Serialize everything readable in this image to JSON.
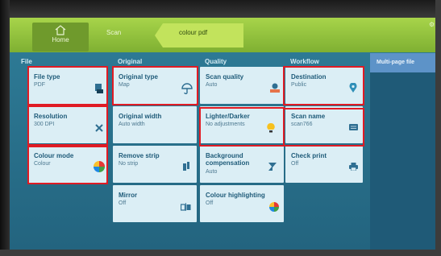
{
  "header": {
    "home_label": "Home",
    "crumb_scan": "Scan",
    "crumb_current": "colour pdf"
  },
  "columns": {
    "file": "File",
    "original": "Original",
    "quality": "Quality",
    "workflow": "Workflow"
  },
  "side_panel": {
    "title": "Multi-page file"
  },
  "tiles": {
    "file_type": {
      "title": "File type",
      "value": "PDF"
    },
    "resolution": {
      "title": "Resolution",
      "value": "300 DPI"
    },
    "colour_mode": {
      "title": "Colour mode",
      "value": "Colour"
    },
    "original_type": {
      "title": "Original type",
      "value": "Map"
    },
    "original_width": {
      "title": "Original width",
      "value": "Auto width"
    },
    "remove_strip": {
      "title": "Remove strip",
      "value": "No strip"
    },
    "mirror": {
      "title": "Mirror",
      "value": "Off"
    },
    "scan_quality": {
      "title": "Scan quality",
      "value": "Auto"
    },
    "lighter_darker": {
      "title": "Lighter/Darker",
      "value": "No adjustments"
    },
    "background_comp": {
      "title_1": "Background",
      "title_2": "compensation",
      "value": "Auto"
    },
    "colour_highlight": {
      "title": "Colour highlighting",
      "value": "Off"
    },
    "destination": {
      "title": "Destination",
      "value": "Public"
    },
    "scan_name": {
      "title": "Scan name",
      "value": "scan766"
    },
    "check_print": {
      "title": "Check print",
      "value": "Off"
    }
  },
  "colors": {
    "topbar": "#9cc83f",
    "screen": "#2a7090",
    "tile": "#dbeef5",
    "tile_title": "#1f5b79",
    "highlight": "#e01b24"
  }
}
